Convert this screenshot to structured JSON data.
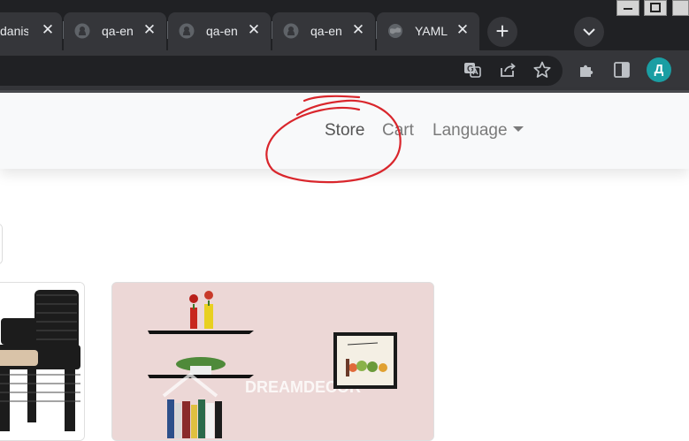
{
  "browser": {
    "tabs": [
      {
        "title": "danis",
        "active": false
      },
      {
        "title": "qa-en",
        "active": false,
        "icon": "github-icon"
      },
      {
        "title": "qa-en",
        "active": false,
        "icon": "github-icon"
      },
      {
        "title": "qa-en",
        "active": false,
        "icon": "github-icon"
      },
      {
        "title": "YAML",
        "active": false,
        "icon": "globe-icon"
      }
    ],
    "profile_initial": "Д",
    "colors": {
      "tabstrip": "#202124",
      "tab": "#35363a",
      "avatar": "#1a9ea3"
    }
  },
  "navbar": {
    "links": [
      {
        "label": "Store"
      },
      {
        "label": "Cart"
      },
      {
        "label": "Language"
      }
    ]
  },
  "products": [
    {
      "name": "rattan chair",
      "image": "black wicker chair with beige cushion"
    },
    {
      "name": "corner shelf",
      "image": "black corner wall shelves with books, vase and framed picture",
      "watermark": "DREAMDECOR"
    }
  ],
  "annotation": {
    "shape": "hand-drawn circle around Store",
    "color": "#d9262c"
  }
}
